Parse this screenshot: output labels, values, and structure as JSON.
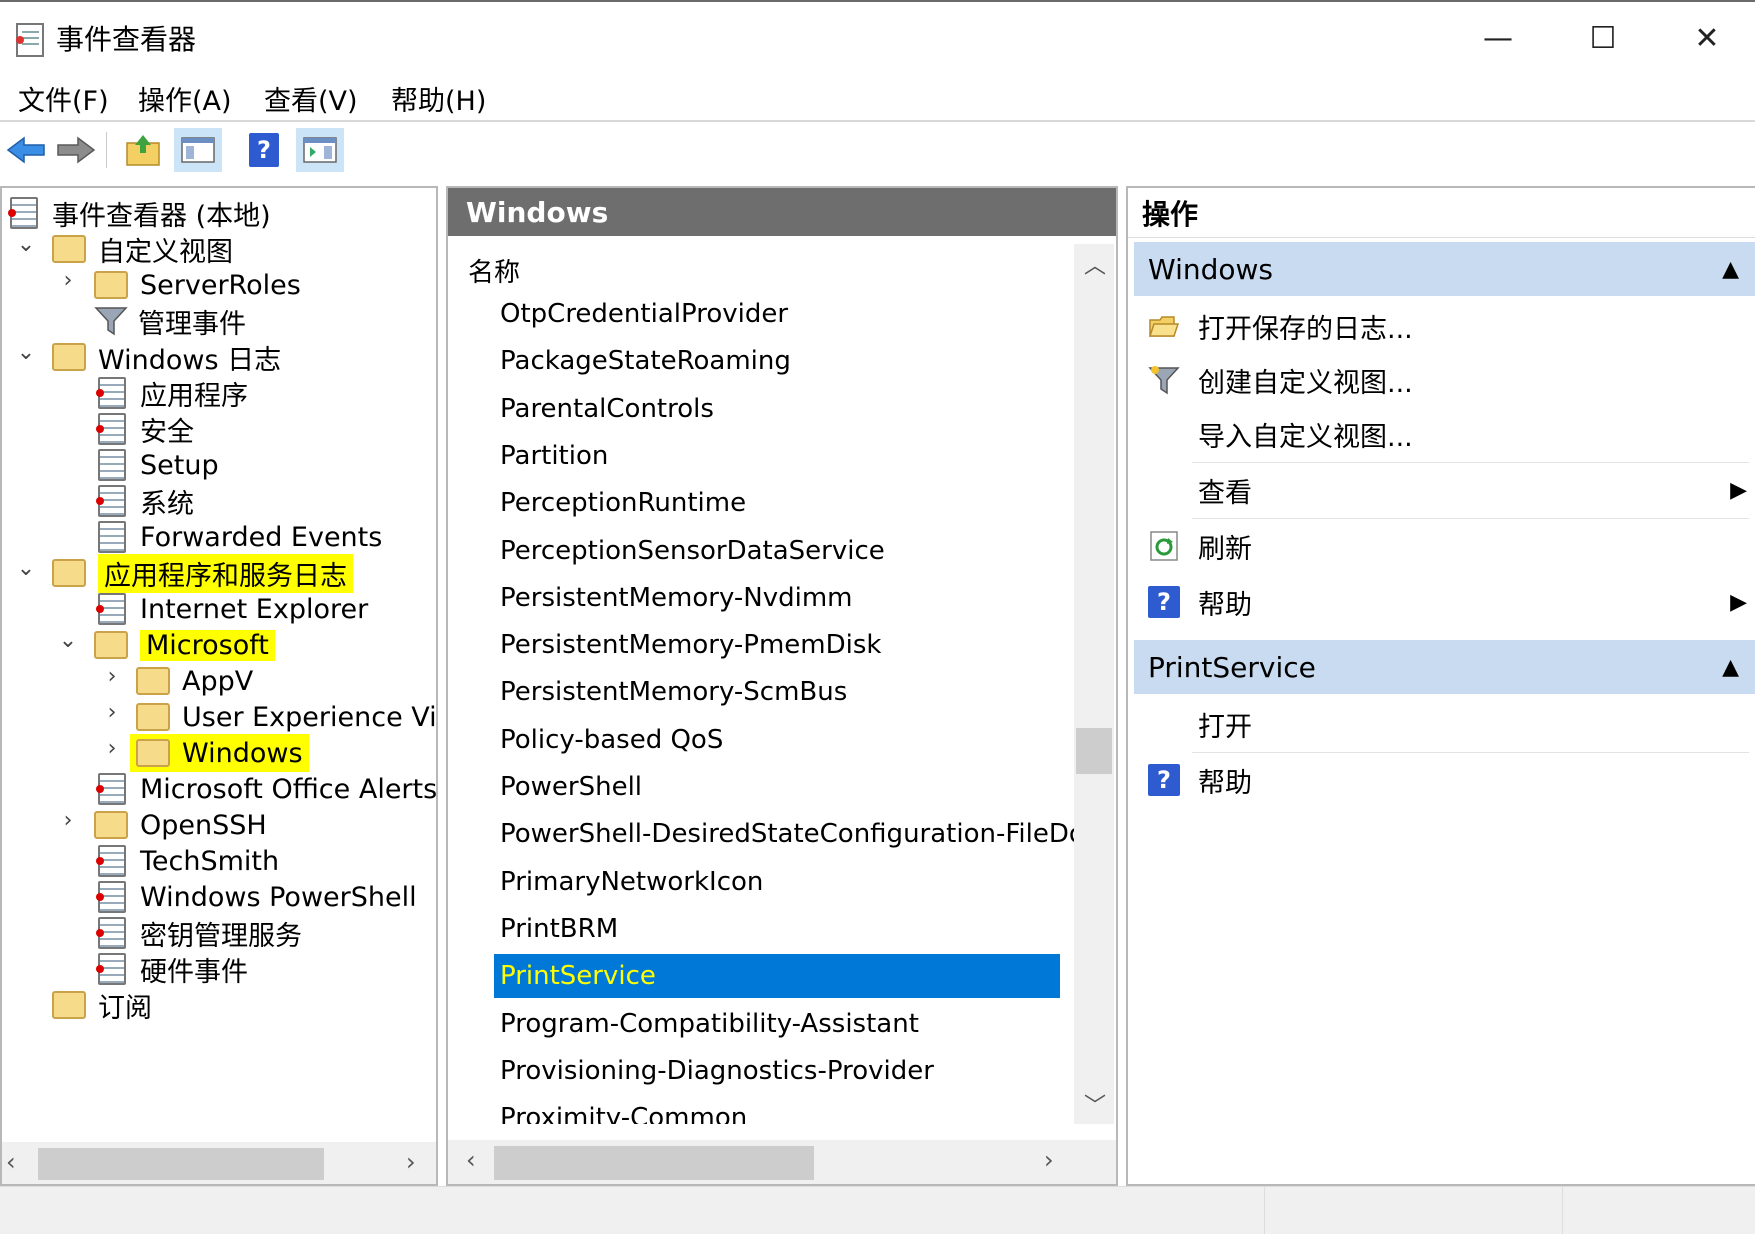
{
  "window": {
    "title": "事件查看器",
    "minimize_glyph": "—",
    "maximize_glyph": "☐",
    "close_glyph": "✕"
  },
  "menu": [
    "文件(F)",
    "操作(A)",
    "查看(V)",
    "帮助(H)"
  ],
  "toolbar": {
    "icons": [
      "back-arrow-icon",
      "forward-arrow-icon",
      "up-folder-icon",
      "show-hide-tree-icon",
      "help-icon",
      "show-hide-action-pane-icon"
    ]
  },
  "tree": {
    "root": "事件查看器 (本地)",
    "custom_views": "自定义视图",
    "server_roles": "ServerRoles",
    "admin_events": "管理事件",
    "windows_logs": "Windows 日志",
    "application": "应用程序",
    "security": "安全",
    "setup": "Setup",
    "system": "系统",
    "forwarded": "Forwarded Events",
    "apps_services": "应用程序和服务日志",
    "internet_explorer": "Internet Explorer",
    "microsoft": "Microsoft",
    "appv": "AppV",
    "uev": "User Experience Virtu",
    "windows": "Windows",
    "office_alerts": "Microsoft Office Alerts",
    "openssh": "OpenSSH",
    "techsmith": "TechSmith",
    "powershell": "Windows PowerShell",
    "key_mgmt": "密钥管理服务",
    "hardware": "硬件事件",
    "subscriptions": "订阅"
  },
  "list": {
    "header": "Windows",
    "column": "名称",
    "items": [
      "OtpCredentialProvider",
      "PackageStateRoaming",
      "ParentalControls",
      "Partition",
      "PerceptionRuntime",
      "PerceptionSensorDataService",
      "PersistentMemory-Nvdimm",
      "PersistentMemory-PmemDisk",
      "PersistentMemory-ScmBus",
      "Policy-based QoS",
      "PowerShell",
      "PowerShell-DesiredStateConfiguration-FileDow",
      "PrimaryNetworkIcon",
      "PrintBRM",
      "PrintService",
      "Program-Compatibility-Assistant",
      "Provisioning-Diagnostics-Provider",
      "Proximity-Common"
    ],
    "selected": "PrintService"
  },
  "actions": {
    "header": "操作",
    "group1": "Windows",
    "open_saved": "打开保存的日志...",
    "create_view": "创建自定义视图...",
    "import_view": "导入自定义视图...",
    "view": "查看",
    "refresh": "刷新",
    "help1": "帮助",
    "group2": "PrintService",
    "open": "打开",
    "help2": "帮助"
  },
  "colors": {
    "selection": "#0078d7",
    "highlight": "#ffff00",
    "group_bg": "#c9dbf0",
    "pane_header": "#6e6e6e"
  }
}
